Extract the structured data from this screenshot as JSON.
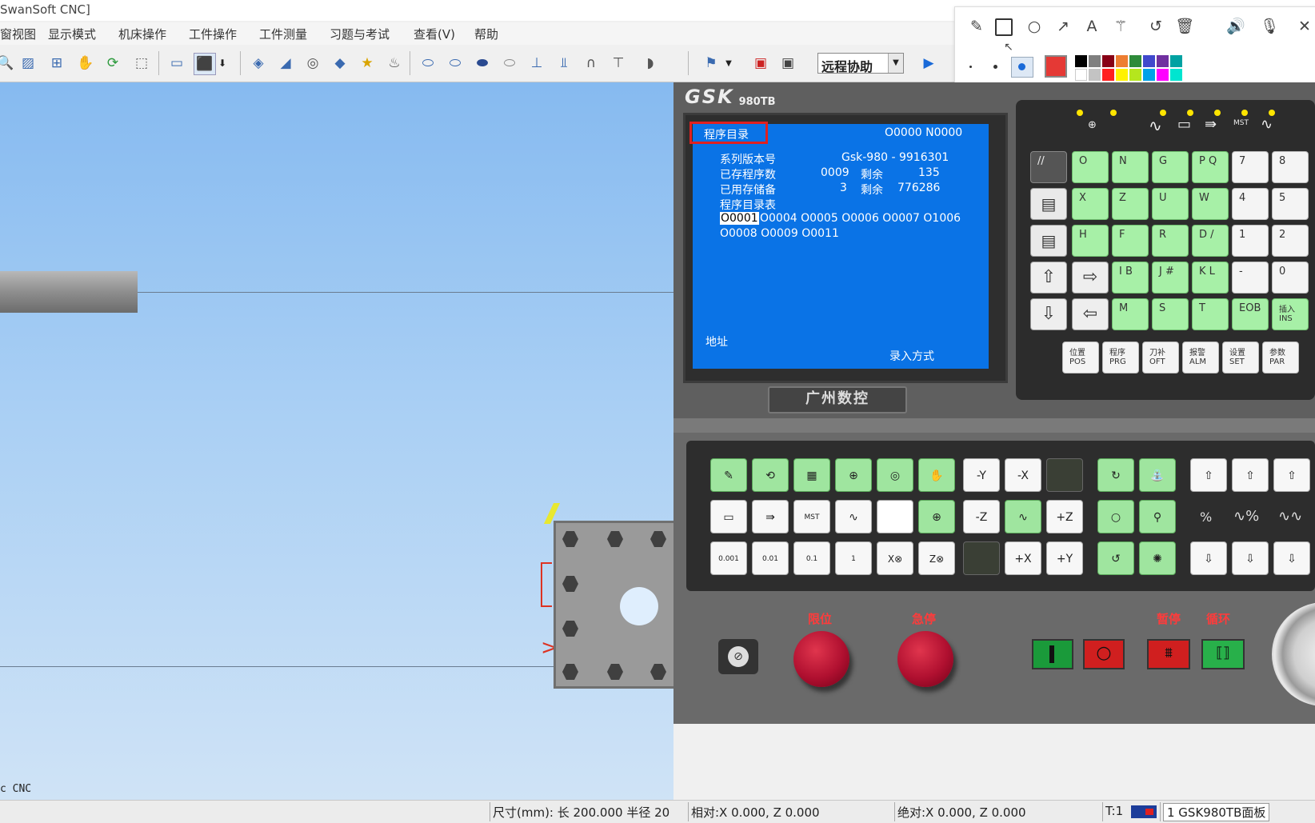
{
  "window": {
    "title": "SwanSoft CNC]"
  },
  "menu": [
    "窗视图",
    "显示模式",
    "机床操作",
    "工件操作",
    "工件测量",
    "习题与考试",
    "查看(V)",
    "帮助"
  ],
  "toolbar": {
    "remote_select": "远程协助"
  },
  "viewport": {
    "caption": "c CNC"
  },
  "panel": {
    "brand": "GSK",
    "model": "980TB",
    "screen": {
      "title": "程序目录",
      "prog_header": "O0000 N0000",
      "rows": [
        {
          "label": "系列版本号",
          "value": "Gsk-980 - 9916301"
        },
        {
          "label": "已存程序数",
          "value": "0009",
          "label2": "剩余",
          "value2": "135"
        },
        {
          "label": "已用存储备",
          "value": "3",
          "label2": "剩余",
          "value2": "776286"
        }
      ],
      "dir_label": "程序目录表",
      "selected_program": "O0001",
      "programs_line1": "O0004 O0005 O0006 O0007 O1006",
      "programs_line2": "O0008 O0009 O0011",
      "address_label": "地址",
      "mode": "录入方式"
    },
    "logo_text": "广州数控",
    "keys": {
      "row1": [
        "//",
        "O",
        "N",
        "G",
        "P Q",
        "7",
        "8"
      ],
      "row2": [
        "X",
        "Z",
        "U",
        "W",
        "4",
        "5"
      ],
      "row3": [
        "H",
        "F",
        "R",
        "D /",
        "1",
        "2"
      ],
      "row4": [
        "I B",
        "J #",
        "K L",
        "-",
        "0"
      ],
      "row5": [
        "M",
        "S",
        "T",
        "EOB",
        "插入 INS"
      ],
      "func": [
        "位置 POS",
        "程序 PRG",
        "刀补 OFT",
        "报警 ALM",
        "设置 SET",
        "参数 PAR"
      ]
    },
    "jog": {
      "minus_y": "-Y",
      "minus_x": "-X",
      "minus_z": "-Z",
      "plus_z": "+Z",
      "plus_x": "+X",
      "plus_y": "+Y",
      "x_zero": "X⊗",
      "z_zero": "Z⊗",
      "steps": [
        "0.001",
        "0.01",
        "0.1",
        "1"
      ]
    },
    "bottom": {
      "limit": "限位",
      "estop": "急停",
      "pause": "暂停",
      "cycle": "循环"
    }
  },
  "statusbar": {
    "size": "尺寸(mm): 长 200.000 半径  20",
    "relative": "相对:X      0.000, Z      0.000",
    "absolute": "绝对:X      0.000, Z      0.000",
    "tool": "T:1",
    "panel_name": "1 GSK980TB面板"
  },
  "colors": {
    "screen_blue": "#0a73e6",
    "key_green": "#a7f0a7",
    "estop_red": "#c0102f",
    "highlight_red": "#e02020"
  }
}
